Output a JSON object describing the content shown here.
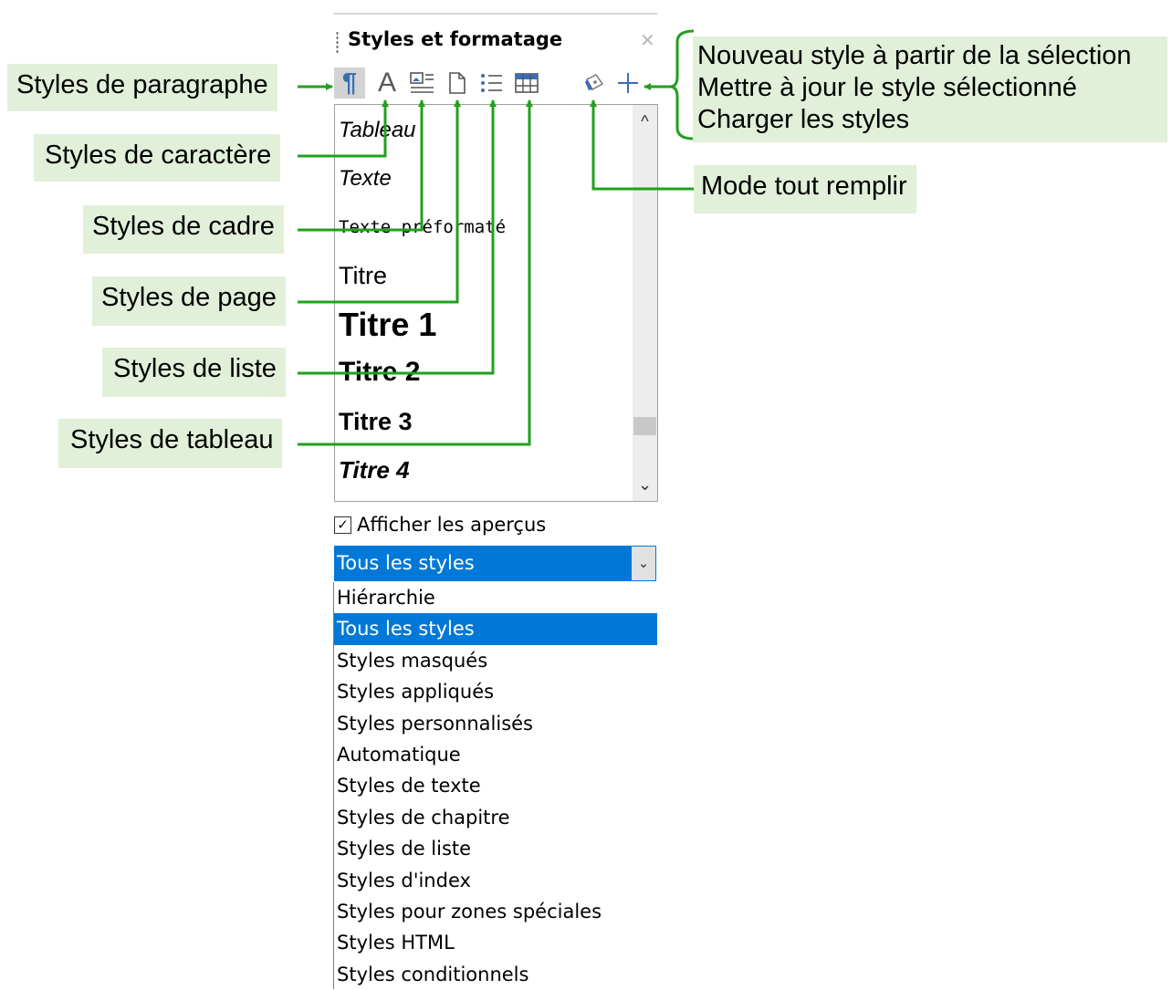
{
  "panel": {
    "title": "Styles et formatage",
    "close_icon": "close-icon",
    "toolbar": [
      {
        "name": "paragraph-styles-icon",
        "glyph": "¶"
      },
      {
        "name": "character-styles-icon",
        "glyph": "A"
      },
      {
        "name": "frame-styles-icon",
        "glyph": "picture"
      },
      {
        "name": "page-styles-icon",
        "glyph": "page"
      },
      {
        "name": "list-styles-icon",
        "glyph": "list"
      },
      {
        "name": "table-styles-icon",
        "glyph": "table"
      },
      {
        "name": "fill-format-mode-icon",
        "glyph": "paint-bucket"
      },
      {
        "name": "styles-actions-icon",
        "glyph": "+"
      }
    ],
    "styles_list": [
      "Tableau",
      "Texte",
      "Texte préformaté",
      "Titre",
      "Titre 1",
      "Titre 2",
      "Titre 3",
      "Titre 4"
    ],
    "show_previews_label": "Afficher les aperçus",
    "show_previews_checked": true,
    "filter_selected": "Tous les styles",
    "filter_options": [
      "Hiérarchie",
      "Tous les styles",
      "Styles masqués",
      "Styles appliqués",
      "Styles personnalisés",
      "Automatique",
      "Styles de texte",
      "Styles de chapitre",
      "Styles de liste",
      "Styles d'index",
      "Styles pour zones spéciales",
      "Styles HTML",
      "Styles conditionnels"
    ],
    "highlighted_option_index": 1
  },
  "callouts": {
    "paragraph": "Styles de paragraphe",
    "character": "Styles de caractère",
    "frame": "Styles de cadre",
    "page": "Styles de page",
    "list": "Styles de liste",
    "table": "Styles de tableau",
    "new_style": "Nouveau style à partir de la sélection",
    "update_style": "Mettre à jour le style sélectionné",
    "load_styles": "Charger les styles",
    "fill_mode": "Mode tout remplir"
  },
  "colors": {
    "callout_bg": "#e2efd9",
    "callout_line": "#22a01e",
    "selection": "#0078d7",
    "icon_blue": "#3a6fb5"
  }
}
